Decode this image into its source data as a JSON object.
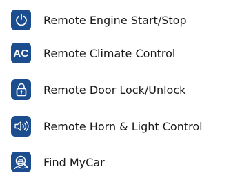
{
  "theme": {
    "accent": "#1c4e8f",
    "text_color": "#1a1a1a"
  },
  "features": [
    {
      "label": "Remote Engine Start/Stop",
      "icon": "power-icon"
    },
    {
      "label": "Remote Climate Control",
      "icon": "ac-icon",
      "icon_text": "AC"
    },
    {
      "label": "Remote Door Lock/Unlock",
      "icon": "lock-icon"
    },
    {
      "label": "Remote Horn & Light Control",
      "icon": "horn-icon"
    },
    {
      "label": "Find MyCar",
      "icon": "find-car-icon"
    }
  ]
}
